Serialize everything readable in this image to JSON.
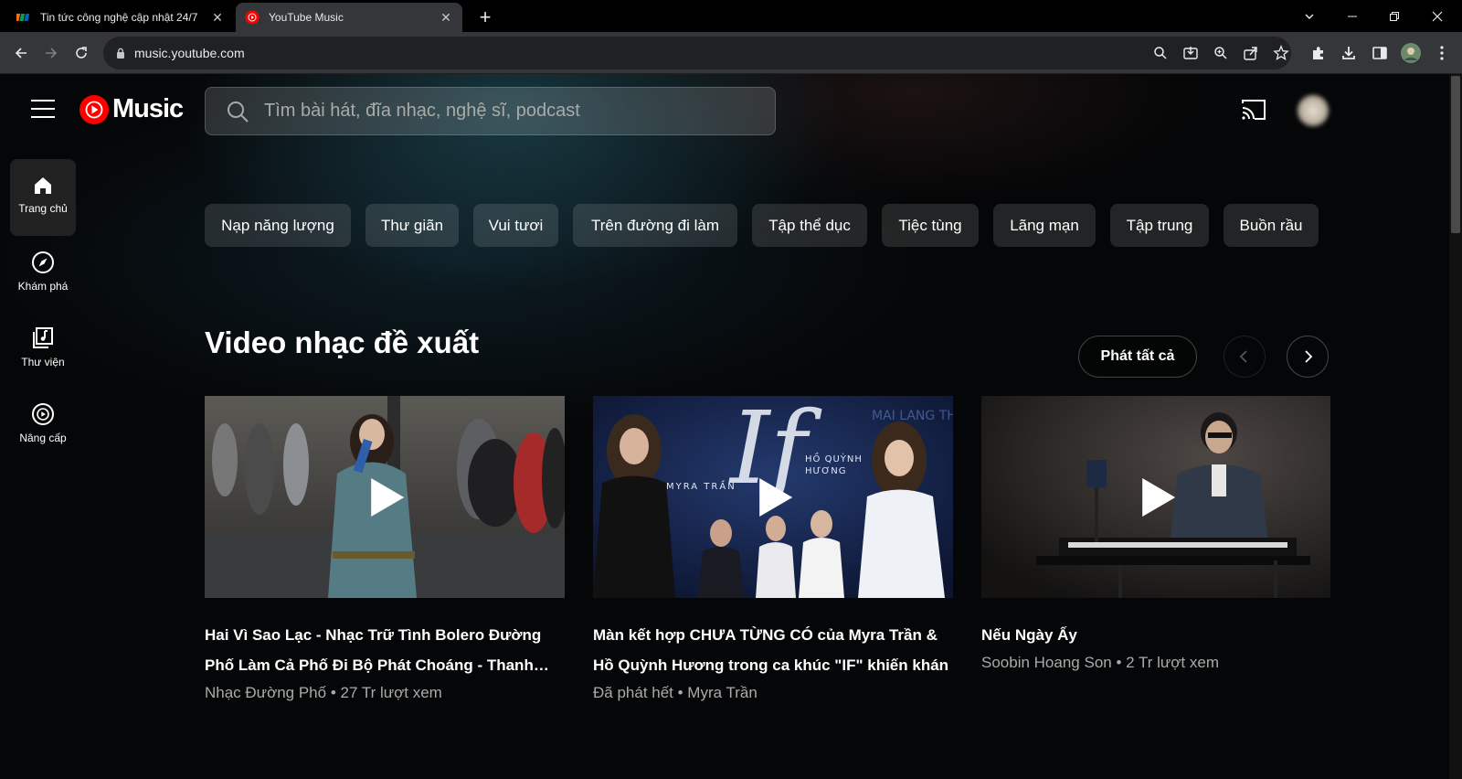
{
  "browser": {
    "tabs": [
      {
        "title": "Tin tức công nghệ cập nhật 24/7",
        "active": false,
        "favicon": "fpt-favicon"
      },
      {
        "title": "YouTube Music",
        "active": true,
        "favicon": "youtube-music-favicon"
      }
    ],
    "address": "music.youtube.com"
  },
  "header": {
    "logo_text": "Music",
    "search_placeholder": "Tìm bài hát, đĩa nhạc, nghệ sĩ, podcast"
  },
  "nav": [
    {
      "label": "Trang chủ",
      "icon": "home-icon",
      "active": true
    },
    {
      "label": "Khám phá",
      "icon": "compass-icon",
      "active": false
    },
    {
      "label": "Thư viện",
      "icon": "library-icon",
      "active": false
    },
    {
      "label": "Nâng cấp",
      "icon": "upgrade-icon",
      "active": false
    }
  ],
  "chips": [
    "Nạp năng lượng",
    "Thư giãn",
    "Vui tươi",
    "Trên đường đi làm",
    "Tập thể dục",
    "Tiệc tùng",
    "Lãng mạn",
    "Tập trung",
    "Buồn rầu"
  ],
  "section": {
    "title": "Video nhạc đề xuất",
    "play_all": "Phát tất cả"
  },
  "cards": [
    {
      "title": "Hai Vì Sao Lạc - Nhạc Trữ Tình Bolero Đường Phố Làm Cả Phố Đi Bộ Phát Choáng - Thanh…",
      "meta": "Nhạc Đường Phố • 27 Tr lượt xem"
    },
    {
      "title": "Màn kết hợp CHƯA TỪNG CÓ của Myra Trần & Hồ Quỳnh Hương trong ca khúc \"IF\" khiến khán",
      "meta": "Đã phát hết • Myra Trần",
      "thumb_text": {
        "big": "If",
        "left": "MYRA TRẦN",
        "right": "HỒ QUỲNH\nHƯƠNG",
        "corner": "MAI LANG THANG"
      }
    },
    {
      "title": "Nếu Ngày Ấy",
      "meta": "Soobin Hoang Son • 2 Tr lượt xem"
    }
  ],
  "colors": {
    "accent": "#ff0000",
    "meta": "#aaaaaa",
    "chip_bg": "#2a2e30"
  }
}
